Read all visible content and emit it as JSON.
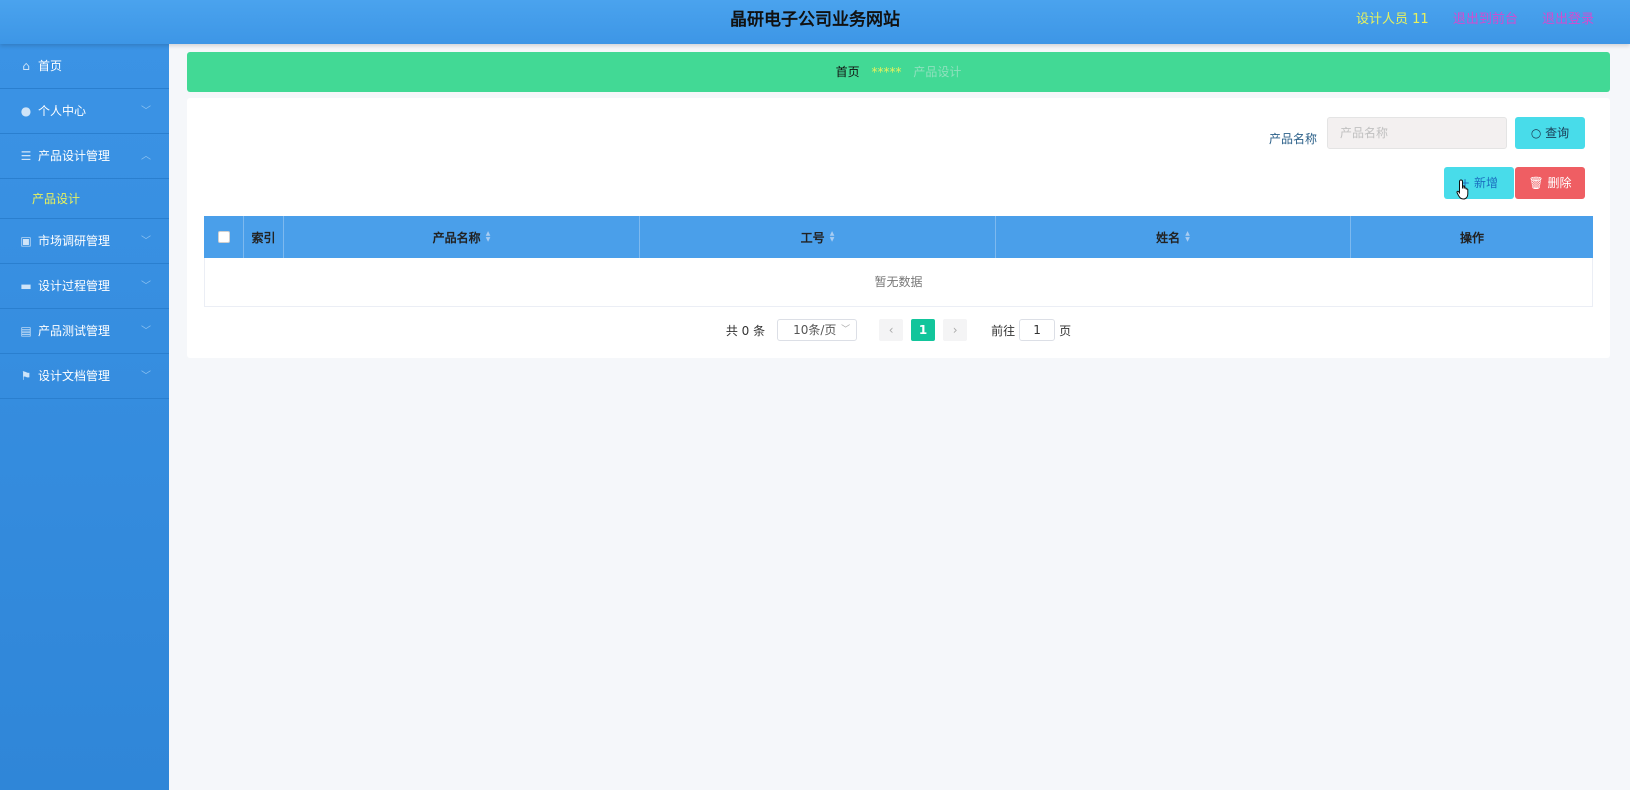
{
  "header": {
    "title": "晶研电子公司业务网站",
    "user": "设计人员 11",
    "front_link": "退出到前台",
    "logout_link": "退出登录"
  },
  "sidebar": {
    "items": [
      {
        "label": "首页",
        "icon": "home-icon"
      },
      {
        "label": "个人中心",
        "icon": "user-icon"
      },
      {
        "label": "产品设计管理",
        "icon": "list-icon"
      },
      {
        "label": "产品设计",
        "icon": ""
      },
      {
        "label": "市场调研管理",
        "icon": "clipboard-icon"
      },
      {
        "label": "设计过程管理",
        "icon": "briefcase-icon"
      },
      {
        "label": "产品测试管理",
        "icon": "printer-icon"
      },
      {
        "label": "设计文档管理",
        "icon": "flag-icon"
      }
    ]
  },
  "breadcrumb": {
    "home": "首页",
    "separator": "*****",
    "current": "产品设计"
  },
  "search": {
    "label": "产品名称",
    "placeholder": "产品名称",
    "query_button": "查询"
  },
  "toolbar": {
    "add_button": "新增",
    "delete_button": "删除"
  },
  "table": {
    "columns": [
      "索引",
      "产品名称",
      "工号",
      "姓名",
      "操作"
    ],
    "empty_text": "暂无数据"
  },
  "pagination": {
    "total": "共 0 条",
    "page_size": "10条/页",
    "current_page": "1",
    "goto_label": "前往",
    "goto_value": "1",
    "page_unit": "页"
  },
  "colors": {
    "header_bg": "#4aa3ee",
    "sidebar_bg": "#3b93e5",
    "breadcrumb_bg": "#42d995",
    "primary_button": "#48dcea",
    "danger_button": "#ef5e63",
    "active_page": "#12c59b"
  }
}
